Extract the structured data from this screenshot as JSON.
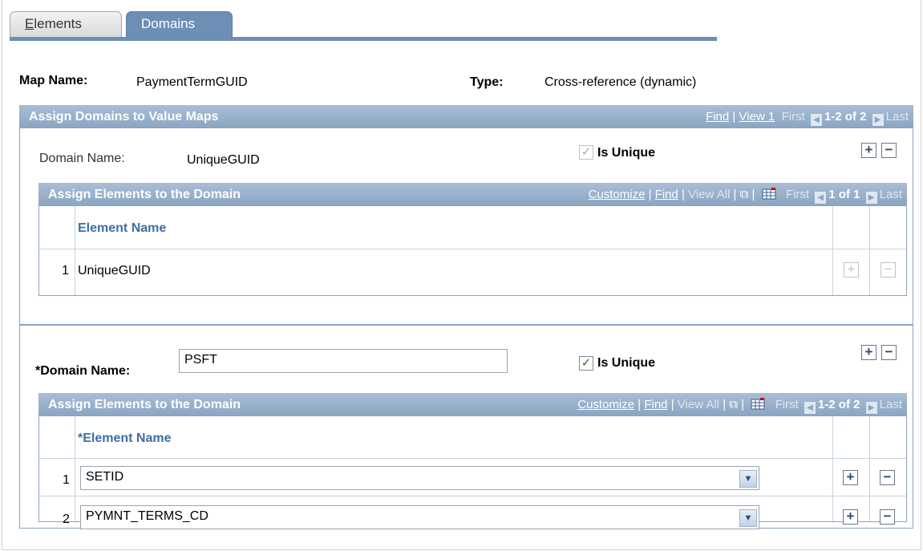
{
  "tabs": [
    {
      "label": "Elements",
      "accesskey": "E",
      "rest": "lements"
    },
    {
      "label": "Domains"
    }
  ],
  "map": {
    "name_label": "Map Name:",
    "name_value": "PaymentTermGUID",
    "type_label": "Type:",
    "type_value": "Cross-reference (dynamic)"
  },
  "outer_panel": {
    "title": "Assign Domains to Value Maps",
    "nav": {
      "find": "Find",
      "sep": "|",
      "view": "View 1",
      "first": "First",
      "range": "1-2 of 2",
      "last": "Last"
    }
  },
  "domain1": {
    "name_label": "Domain Name:",
    "name_value": "UniqueGUID",
    "unique_label": "Is Unique",
    "unique_checked": true,
    "grid": {
      "title": "Assign Elements to the Domain",
      "nav": {
        "customize": "Customize",
        "sep": "|",
        "find": "Find",
        "view_all": "View All",
        "first": "First",
        "range": "1 of 1",
        "last": "Last"
      },
      "column_header": "Element Name",
      "rows": [
        {
          "num": "1",
          "value": "UniqueGUID"
        }
      ]
    }
  },
  "domain2": {
    "name_label": "*Domain Name:",
    "name_value": "PSFT",
    "unique_label": "Is Unique",
    "unique_checked": true,
    "grid": {
      "title": "Assign Elements to the Domain",
      "nav": {
        "customize": "Customize",
        "sep": "|",
        "find": "Find",
        "view_all": "View All",
        "first": "First",
        "range": "1-2 of 2",
        "last": "Last"
      },
      "column_header": "*Element Name",
      "rows": [
        {
          "num": "1",
          "value": "SETID"
        },
        {
          "num": "2",
          "value": "PYMNT_TERMS_CD"
        }
      ]
    }
  },
  "glyphs": {
    "plus": "+",
    "minus": "−",
    "check": "✓",
    "prev": "◀",
    "next": "▶",
    "dropdown": "▼",
    "popout": "⧉"
  },
  "colors": {
    "header_bar": "#8aa4c2",
    "active_tab": "#6d8fb5",
    "column_header_text": "#3c6ea3"
  }
}
